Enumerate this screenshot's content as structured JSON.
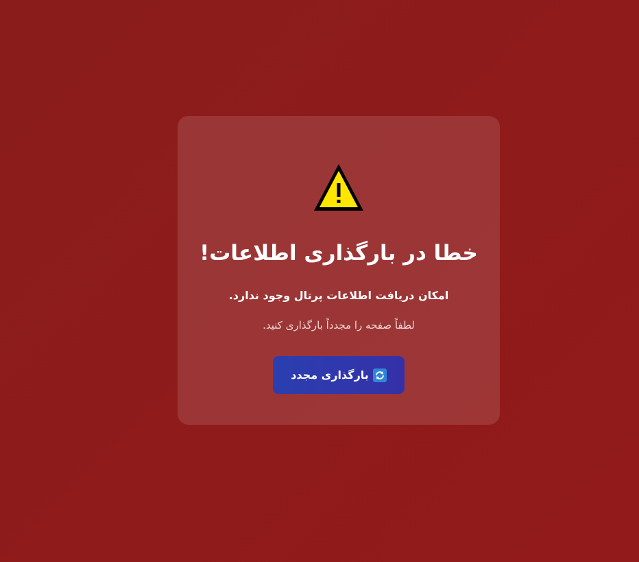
{
  "error": {
    "title": "خطا در بارگذاری اطلاعات!",
    "message": "امکان دریافت اطلاعات پرتال وجود ندارد.",
    "hint": "لطفاً صفحه را مجدداً بارگذاری کنید.",
    "reload_label": "بارگذاری مجدد",
    "warning_icon": "warning-triangle-icon",
    "reload_icon": "reload-icon"
  },
  "colors": {
    "background": "#8f1b1b",
    "warning_yellow": "#ffe600",
    "button": "#2d3ab0"
  }
}
